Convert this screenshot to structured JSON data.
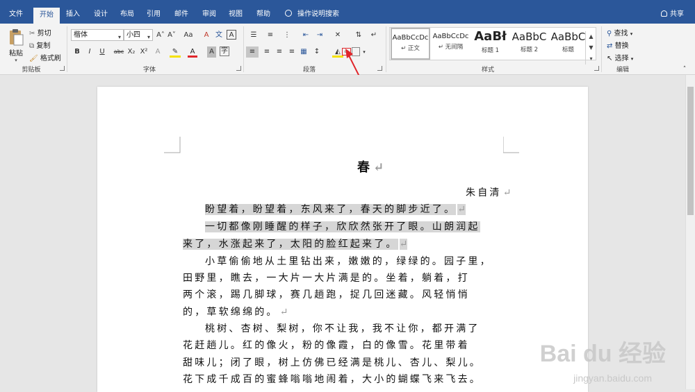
{
  "tabs": [
    {
      "label": "文件"
    },
    {
      "label": "开始"
    },
    {
      "label": "插入"
    },
    {
      "label": "设计"
    },
    {
      "label": "布局"
    },
    {
      "label": "引用"
    },
    {
      "label": "邮件"
    },
    {
      "label": "审阅"
    },
    {
      "label": "视图"
    },
    {
      "label": "帮助"
    }
  ],
  "help_search": "操作说明搜索",
  "share_label": "共享",
  "clipboard": {
    "paste": "粘贴",
    "cut": "剪切",
    "copy": "复制",
    "format_painter": "格式刷",
    "group": "剪贴板"
  },
  "font": {
    "name": "楷体",
    "size": "小四",
    "grow": "A˄",
    "shrink": "A˅",
    "case": "Aa",
    "bold": "B",
    "italic": "I",
    "underline": "U",
    "strike": "abc",
    "sub": "X₂",
    "sup": "X²",
    "group": "字体"
  },
  "paragraph": {
    "group": "段落"
  },
  "styles": {
    "items": [
      {
        "preview": "AaBbCcDc",
        "name": "↵ 正文"
      },
      {
        "preview": "AaBbCcDc",
        "name": "↵ 无间隔"
      },
      {
        "preview": "AaBł",
        "name": "标题 1"
      },
      {
        "preview": "AaBbC",
        "name": "标题 2"
      },
      {
        "preview": "AaBbC",
        "name": "标题"
      }
    ],
    "group": "样式"
  },
  "editing": {
    "find": "查找",
    "replace": "替换",
    "select": "选择",
    "group": "编辑"
  },
  "document": {
    "title": "春",
    "author": "朱自清",
    "lines": [
      "盼望着，盼望着，东风来了，春天的脚步近了。",
      "一切都像刚睡醒的样子，欣欣然张开了眼。山朗润起",
      "来了，水涨起来了，太阳的脸红起来了。",
      "小草偷偷地从土里钻出来，嫩嫩的，绿绿的。园子里，",
      "田野里，瞧去，一大片一大片满是的。坐着，躺着，打",
      "两个滚，踢几脚球，赛几趟跑，捉几回迷藏。风轻悄悄",
      "的，草软绵绵的。",
      "桃树、杏树、梨树，你不让我，我不让你，都开满了",
      "花赶趟儿。红的像火，粉的像霞，白的像雪。花里带着",
      "甜味儿；闭了眼，树上仿佛已经满是桃儿、杏儿、梨儿。",
      "花下成千成百的蜜蜂嗡嗡地闹着，大小的蝴蝶飞来飞去。"
    ],
    "return_mark": "↵"
  },
  "watermark": {
    "main": "Bai du 经验",
    "sub": "jingyan.baidu.com"
  },
  "colors": {
    "brand": "#2b579a",
    "annotation": "#e0262b",
    "highlight": "#d6d6d6"
  }
}
